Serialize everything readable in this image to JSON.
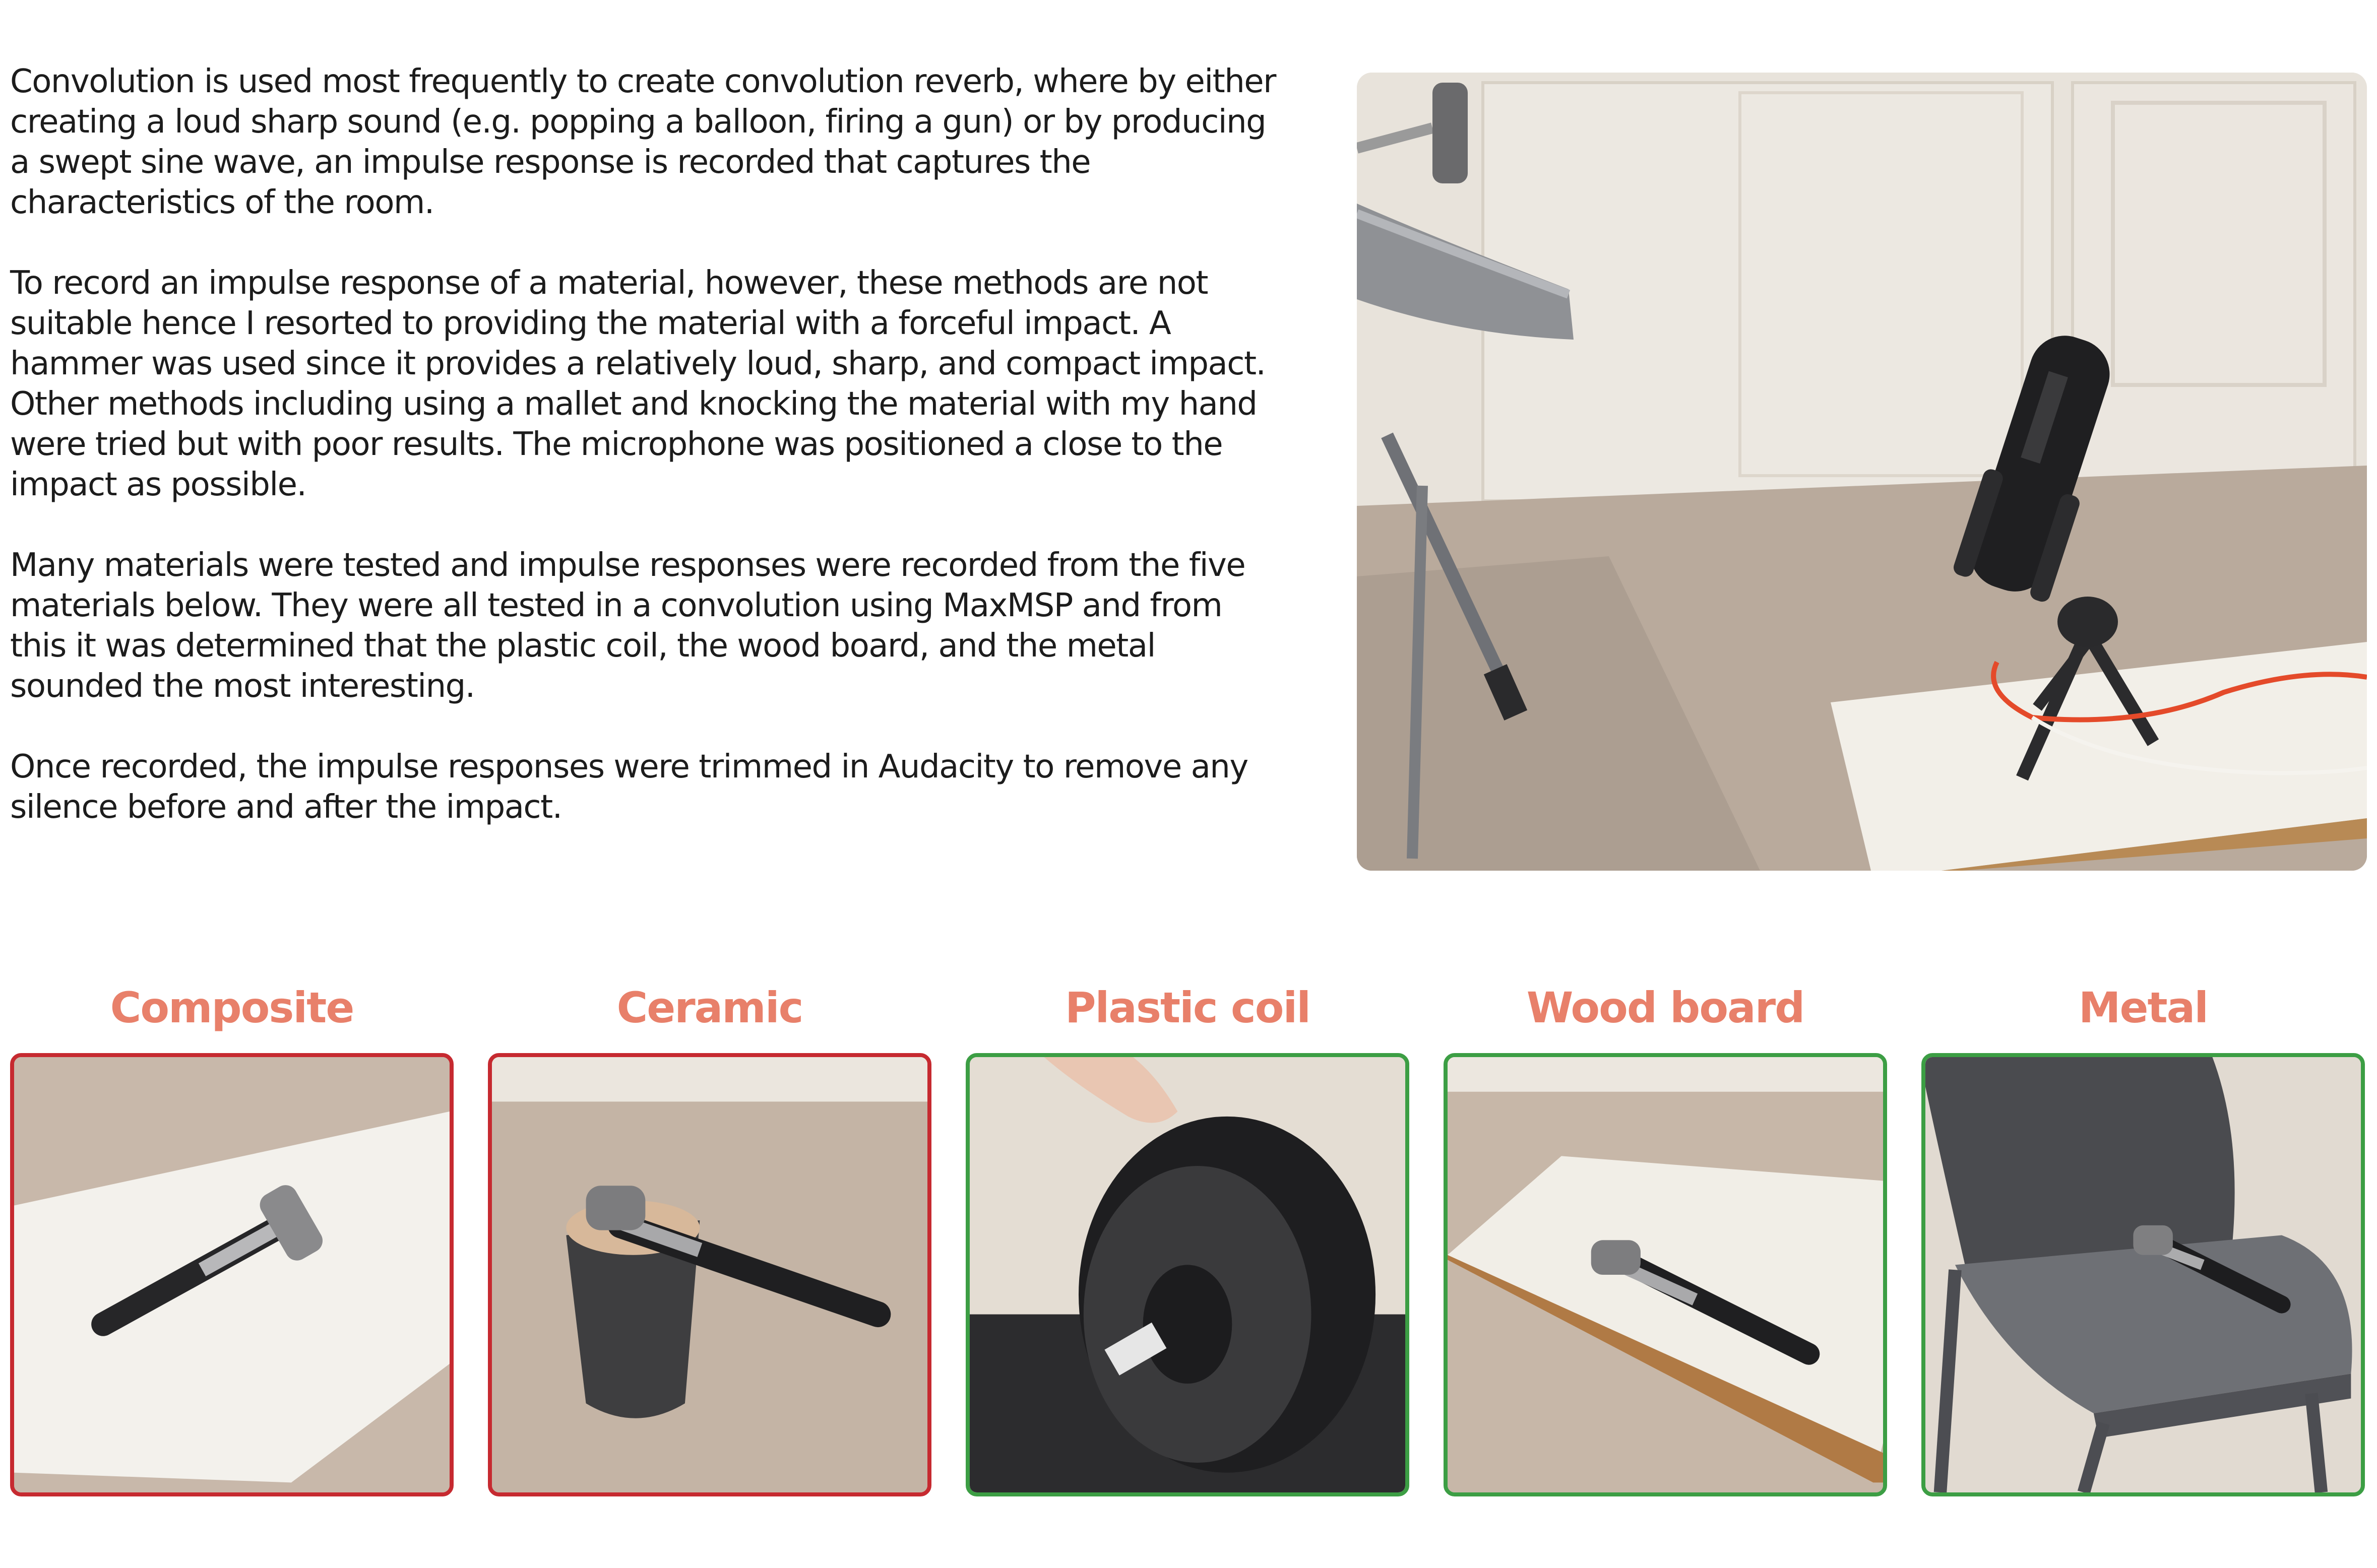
{
  "paragraphs": [
    "Convolution is used most frequently to create convolution reverb, where by either creating a loud sharp sound (e.g. popping a balloon, firing a gun) or by producing a swept sine wave, an impulse response is recorded that captures the characteristics of the room.",
    "To record an impulse response of a material, however, these methods are not suitable hence I resorted to providing the material with a forceful impact. A hammer was used since it provides a relatively loud, sharp, and compact impact. Other methods including using a mallet and knocking the material with my hand were tried but with poor results. The microphone was positioned a close to the impact as possible.",
    "Many materials were tested and impulse responses were recorded from the five materials below. They were all tested in a convolution using MaxMSP and from this it was determined that the plastic coil, the wood board, and the metal sounded the most interesting.",
    "Once recorded, the impulse responses were trimmed in Audacity to remove any silence before and after the impact."
  ],
  "materials": [
    {
      "label": "Composite",
      "selected": false
    },
    {
      "label": "Ceramic",
      "selected": false
    },
    {
      "label": "Plastic coil",
      "selected": true
    },
    {
      "label": "Wood board",
      "selected": true
    },
    {
      "label": "Metal",
      "selected": true
    }
  ],
  "colors": {
    "label": "#e8806a",
    "rejected_border": "#c62a30",
    "selected_border": "#3c9e44"
  }
}
